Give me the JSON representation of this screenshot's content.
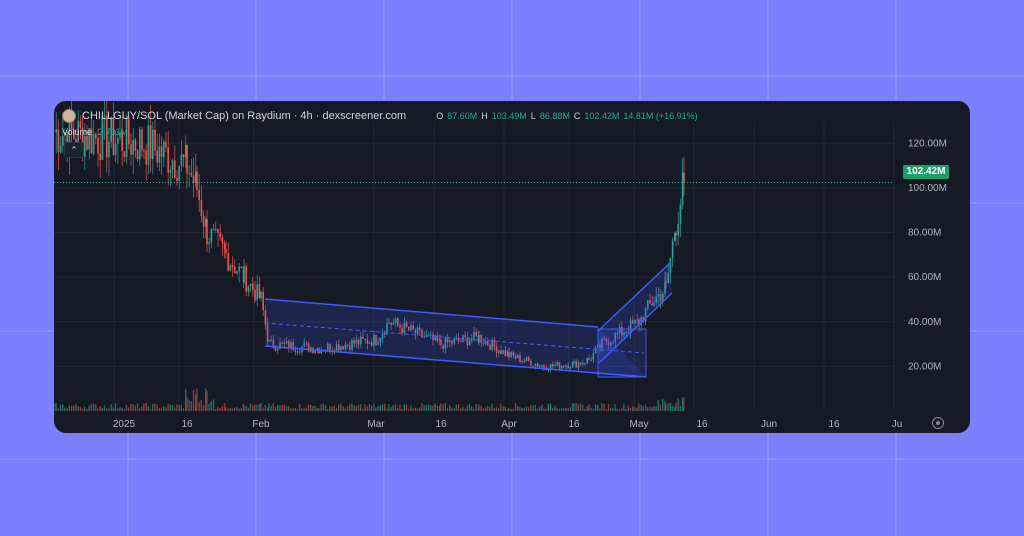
{
  "header": {
    "title": "CHILLGUY/SOL (Market Cap) on Raydium · 4h · dexscreener.com",
    "ohlc": [
      {
        "k": "O",
        "v": "87.60M"
      },
      {
        "k": "H",
        "v": "103.49M"
      },
      {
        "k": "L",
        "v": "86.88M"
      },
      {
        "k": "C",
        "v": "102.42M"
      },
      {
        "k": "",
        "v": "14.81M (+16.91%)"
      }
    ]
  },
  "volume": {
    "label": "Volume",
    "value": "2.731M"
  },
  "collapse_icon": "chevron-up-icon",
  "current_price_label": "102.42M",
  "colors": {
    "background": "#7b80ff",
    "panel": "#161a25",
    "up": "#26a69a",
    "down": "#ef5350",
    "channel": "#3d5afe",
    "badge": "#1e9e6a"
  },
  "chart_data": {
    "type": "candlestick",
    "y_unit": "Market Cap (USD)",
    "ylim": [
      0,
      130000000
    ],
    "y_ticks": [
      "20.00M",
      "40.00M",
      "60.00M",
      "80.00M",
      "100.00M",
      "120.00M"
    ],
    "x_ticks": [
      "2025",
      "16",
      "Feb",
      "Mar",
      "16",
      "Apr",
      "16",
      "May",
      "16",
      "Jun",
      "16",
      "Ju"
    ],
    "current_price": 102420000,
    "series": [
      {
        "name": "close",
        "x": [
          "Jan 1",
          "Jan 10",
          "Jan 16",
          "Jan 18",
          "Jan 20",
          "Jan 24",
          "Jan 28",
          "Feb 1",
          "Feb 3",
          "Feb 15",
          "Mar 1",
          "Mar 5",
          "Mar 16",
          "Mar 25",
          "Apr 1",
          "Apr 10",
          "Apr 16",
          "Apr 20",
          "Apr 24",
          "May 1",
          "May 4",
          "May 8",
          "May 10",
          "May 11"
        ],
        "values": [
          125000000,
          120000000,
          110000000,
          100000000,
          80000000,
          70000000,
          60000000,
          50000000,
          30000000,
          28000000,
          32000000,
          40000000,
          30000000,
          33000000,
          25000000,
          20000000,
          21000000,
          23000000,
          30000000,
          40000000,
          50000000,
          55000000,
          85000000,
          102420000
        ]
      }
    ],
    "annotations": [
      {
        "type": "descending-channel",
        "from": "Feb 3",
        "to": "Apr 24"
      },
      {
        "type": "ascending-channel",
        "from": "Apr 24",
        "to": "May 9"
      }
    ]
  }
}
